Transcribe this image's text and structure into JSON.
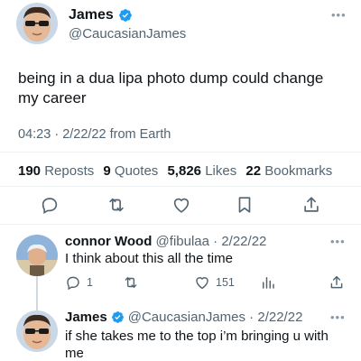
{
  "main_tweet": {
    "display_name": "James",
    "handle": "@CaucasianJames",
    "text": "being in a dua lipa photo dump could change my career",
    "time": "04:23",
    "date": "2/22/22",
    "source": "from Earth",
    "more_icon": "more-dots-icon",
    "verified_icon": "verified-badge-icon"
  },
  "stats": {
    "reposts_count": "190",
    "reposts_label": "Reposts",
    "quotes_count": "9",
    "quotes_label": "Quotes",
    "likes_count": "5,826",
    "likes_label": "Likes",
    "bookmarks_count": "22",
    "bookmarks_label": "Bookmarks"
  },
  "actions": [
    "reply-icon",
    "repost-icon",
    "like-icon",
    "bookmark-icon",
    "share-icon"
  ],
  "replies": [
    {
      "display_name": "connor Wood",
      "handle": "@fibulaa",
      "date": "2/22/22",
      "text": "I think about this all the time",
      "reply_count": "1",
      "repost_count": "",
      "like_count": "151"
    },
    {
      "display_name": "James",
      "handle": "@CaucasianJames",
      "date": "2/22/22",
      "text": "if she takes me to the top i’m bringing u with me"
    }
  ],
  "separator": " · ",
  "colors": {
    "text": "#0f1419",
    "muted": "#536471",
    "verified": "#1d9bf0",
    "divider": "#eff3f4",
    "thread_line": "#cfd9de"
  }
}
